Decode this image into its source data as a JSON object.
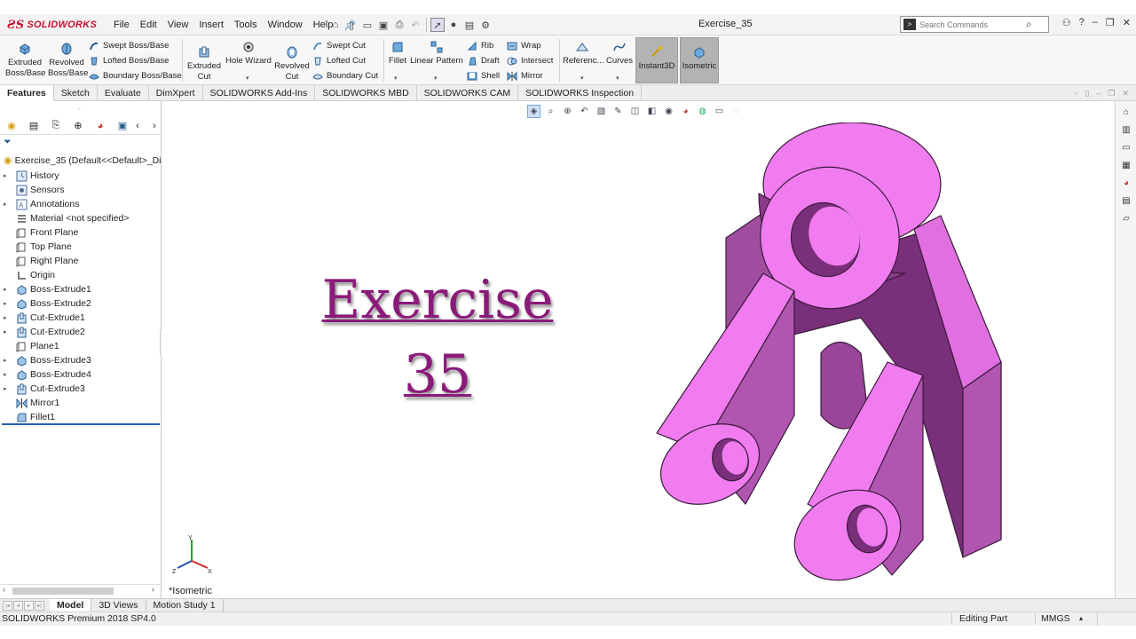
{
  "app": {
    "brand": "SOLIDWORKS",
    "document_title": "Exercise_35"
  },
  "menu": [
    "File",
    "Edit",
    "View",
    "Insert",
    "Tools",
    "Window",
    "Help"
  ],
  "search": {
    "placeholder": "Search Commands"
  },
  "ribbon": {
    "extruded_boss": [
      "Extruded",
      "Boss/Base"
    ],
    "revolved_boss": [
      "Revolved",
      "Boss/Base"
    ],
    "swept_boss": "Swept Boss/Base",
    "lofted_boss": "Lofted Boss/Base",
    "boundary_boss": "Boundary Boss/Base",
    "extruded_cut": [
      "Extruded",
      "Cut"
    ],
    "hole_wizard": "Hole Wizard",
    "revolved_cut": [
      "Revolved",
      "Cut"
    ],
    "swept_cut": "Swept Cut",
    "lofted_cut": "Lofted Cut",
    "boundary_cut": "Boundary Cut",
    "fillet": "Fillet",
    "linear_pattern": "Linear Pattern",
    "rib": "Rib",
    "draft": "Draft",
    "shell": "Shell",
    "wrap": "Wrap",
    "intersect": "Intersect",
    "mirror": "Mirror",
    "reference": "Referenc...",
    "curves": "Curves",
    "instant3d": "Instant3D",
    "isometric": "Isometric"
  },
  "command_tabs": [
    "Features",
    "Sketch",
    "Evaluate",
    "DimXpert",
    "SOLIDWORKS Add-Ins",
    "SOLIDWORKS MBD",
    "SOLIDWORKS CAM",
    "SOLIDWORKS Inspection"
  ],
  "active_command_tab": "Features",
  "tree": {
    "root": "Exercise_35  (Default<<Default>_Dis",
    "items": [
      {
        "label": "History",
        "expandable": true,
        "icon": "history-icon"
      },
      {
        "label": "Sensors",
        "expandable": false,
        "icon": "sensors-icon"
      },
      {
        "label": "Annotations",
        "expandable": true,
        "icon": "annotations-icon"
      },
      {
        "label": "Material <not specified>",
        "expandable": false,
        "icon": "material-icon"
      },
      {
        "label": "Front Plane",
        "expandable": false,
        "icon": "plane-icon"
      },
      {
        "label": "Top Plane",
        "expandable": false,
        "icon": "plane-icon"
      },
      {
        "label": "Right Plane",
        "expandable": false,
        "icon": "plane-icon"
      },
      {
        "label": "Origin",
        "expandable": false,
        "icon": "origin-icon"
      },
      {
        "label": "Boss-Extrude1",
        "expandable": true,
        "icon": "boss-extrude-icon"
      },
      {
        "label": "Boss-Extrude2",
        "expandable": true,
        "icon": "boss-extrude-icon"
      },
      {
        "label": "Cut-Extrude1",
        "expandable": true,
        "icon": "cut-extrude-icon"
      },
      {
        "label": "Cut-Extrude2",
        "expandable": true,
        "icon": "cut-extrude-icon"
      },
      {
        "label": "Plane1",
        "expandable": false,
        "icon": "plane-icon"
      },
      {
        "label": "Boss-Extrude3",
        "expandable": true,
        "icon": "boss-extrude-icon"
      },
      {
        "label": "Boss-Extrude4",
        "expandable": true,
        "icon": "boss-extrude-icon"
      },
      {
        "label": "Cut-Extrude3",
        "expandable": true,
        "icon": "cut-extrude-icon"
      },
      {
        "label": "Mirror1",
        "expandable": false,
        "icon": "mirror-icon"
      },
      {
        "label": "Fillet1",
        "expandable": false,
        "icon": "fillet-icon"
      }
    ]
  },
  "graphics": {
    "title_line1": "Exercise",
    "title_line2": "35",
    "view_name": "*Isometric",
    "model_color": "#f07cf0",
    "title_color": "#8b1a7a"
  },
  "bottom_tabs": [
    "Model",
    "3D Views",
    "Motion Study 1"
  ],
  "active_bottom_tab": "Model",
  "status": {
    "product": "SOLIDWORKS Premium 2018 SP4.0",
    "mode": "Editing Part",
    "units": "MMGS"
  }
}
